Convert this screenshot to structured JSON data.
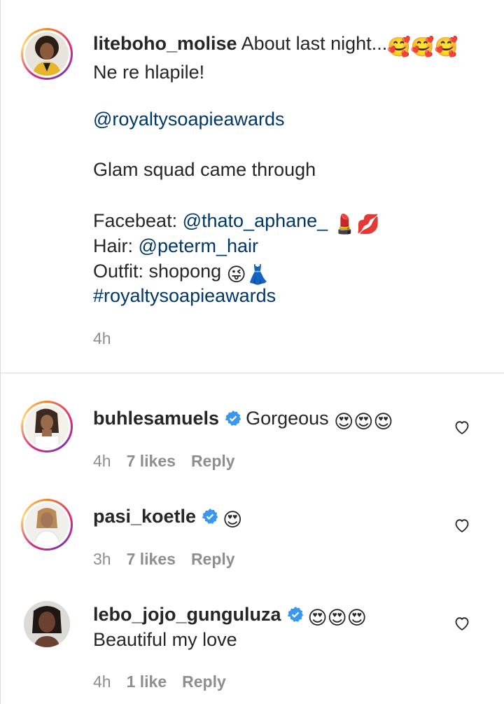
{
  "post": {
    "username": "liteboho_molise",
    "text_line1": "About last night...",
    "emoji_line1": "🥰🥰🥰",
    "line2": "Ne re hlapile!",
    "mention1": "@royaltysoapieawards",
    "line3": "Glam squad came through",
    "facebeat_label": "Facebeat:",
    "facebeat_mention": "@thato_aphane_",
    "facebeat_emoji": "💄💋",
    "hair_label": "Hair:",
    "hair_mention": "@peterm_hair",
    "outfit_text": "Outfit: shopong",
    "outfit_emoji": "😜👗",
    "hashtag": "#royaltysoapieawards",
    "time": "4h"
  },
  "comments": [
    {
      "username": "buhlesamuels",
      "verified": true,
      "text": "Gorgeous",
      "emoji": "😍😍😍",
      "time": "4h",
      "likes": "7 likes",
      "reply": "Reply"
    },
    {
      "username": "pasi_koetle",
      "verified": true,
      "text": "",
      "emoji": "😍",
      "time": "3h",
      "likes": "7 likes",
      "reply": "Reply"
    },
    {
      "username": "lebo_jojo_gunguluza",
      "verified": true,
      "text": "Beautiful my love",
      "emoji": "😍😍😍",
      "time": "4h",
      "likes": "1 like",
      "reply": "Reply"
    }
  ],
  "icons": {
    "heart": "heart-outline-icon",
    "verified": "verified-badge-icon"
  },
  "colors": {
    "link": "#00376b",
    "verified": "#3897f0",
    "meta": "#8e8e8e"
  }
}
